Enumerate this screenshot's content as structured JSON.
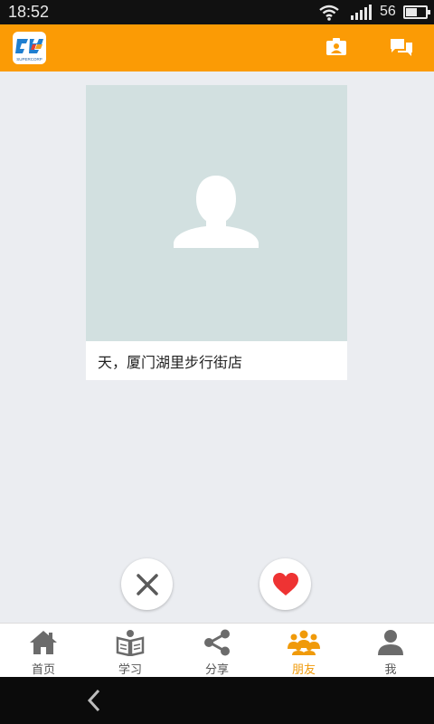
{
  "status_bar": {
    "time": "18:52",
    "battery_level": "56",
    "icons": [
      "wifi-icon",
      "signal-icon",
      "battery-icon"
    ]
  },
  "app_bar": {
    "logo_text": "SUPERCORP",
    "icons": [
      "contact-card-icon",
      "chat-icon"
    ],
    "accent_color": "#fb9b05"
  },
  "card": {
    "photo_icon": "person-placeholder-icon",
    "caption": "天，厦门湖里步行街店"
  },
  "actions": {
    "dislike_icon": "close-icon",
    "like_icon": "heart-icon",
    "like_color": "#ee3333"
  },
  "bottom_nav": {
    "active_index": 3,
    "active_color": "#f09a0a",
    "items": [
      {
        "label": "首页",
        "icon": "home-icon"
      },
      {
        "label": "学习",
        "icon": "book-reader-icon"
      },
      {
        "label": "分享",
        "icon": "share-icon"
      },
      {
        "label": "朋友",
        "icon": "friends-icon"
      },
      {
        "label": "我",
        "icon": "user-icon"
      }
    ]
  },
  "system_nav": {
    "back_icon": "back-chevron-icon"
  }
}
